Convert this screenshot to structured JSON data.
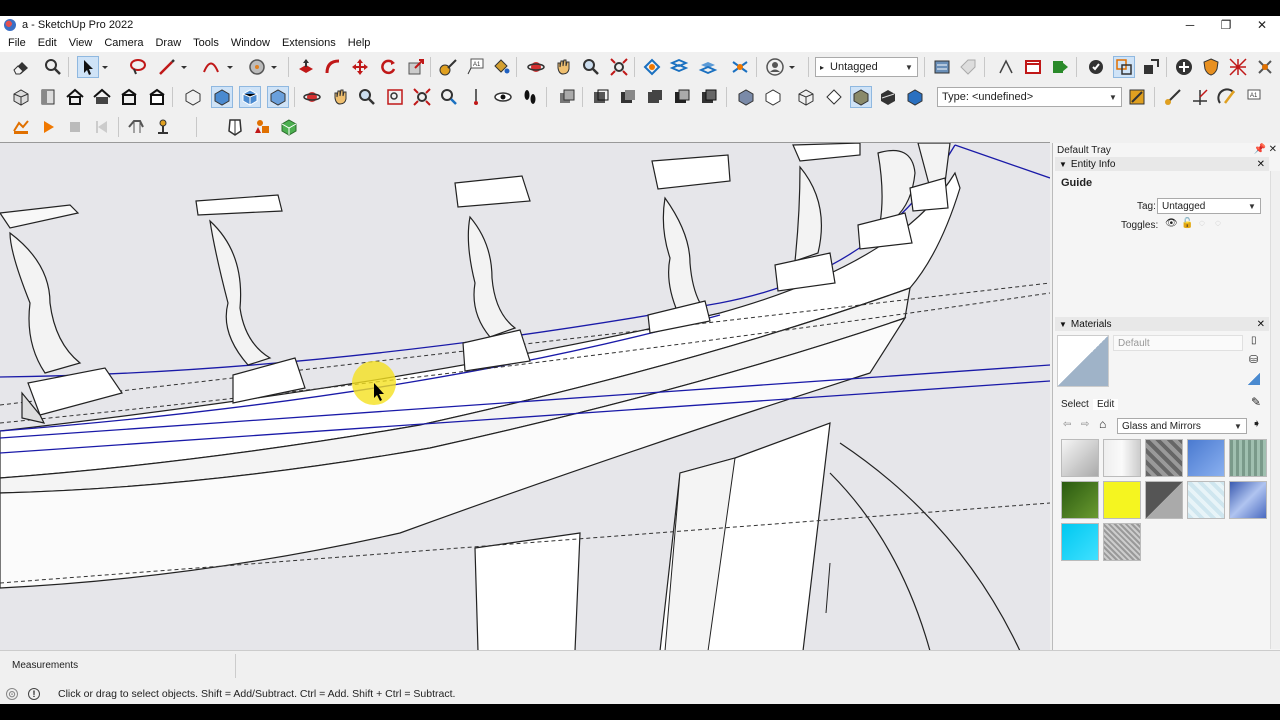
{
  "window": {
    "title": "a - SketchUp Pro 2022",
    "minimize": "─",
    "maximize": "❐",
    "close": "✕"
  },
  "menu": [
    "File",
    "Edit",
    "View",
    "Camera",
    "Draw",
    "Tools",
    "Window",
    "Extensions",
    "Help"
  ],
  "toolbar": {
    "tag_dropdown_value": "Untagged",
    "type_dropdown_value": "Type: <undefined>"
  },
  "tray": {
    "title": "Default Tray",
    "entity_info": {
      "header": "Entity Info",
      "entity_type": "Guide",
      "tag_label": "Tag:",
      "tag_value": "Untagged",
      "toggles_label": "Toggles:"
    },
    "materials": {
      "header": "Materials",
      "current_name": "Default",
      "tab_select": "Select",
      "tab_edit": "Edit",
      "collection": "Glass and Mirrors"
    }
  },
  "measurements": {
    "label": "Measurements",
    "value": ""
  },
  "status": {
    "text": "Click or drag to select objects. Shift = Add/Subtract. Ctrl = Add. Shift + Ctrl = Subtract."
  },
  "colors": {
    "viewport_bg": "#e6e6ea",
    "guide_blue": "#1a1aa8",
    "cursor_highlight": "#f5e11f",
    "accent_orange": "#f07800"
  },
  "icons": {
    "row1": [
      "eraser",
      "search",
      "select",
      "lasso",
      "paint-bucket",
      "line",
      "arc",
      "circle",
      "push-pull",
      "follow-me",
      "move",
      "rotate",
      "scale",
      "tape-measure",
      "text",
      "paint",
      "orbit",
      "pan",
      "zoom",
      "zoom-extents",
      "section-plane",
      "section",
      "section-fill",
      "section-cut",
      "profile"
    ],
    "row2": [
      "views",
      "iso",
      "top",
      "front",
      "right",
      "back",
      "left",
      "move-axes",
      "paint-face",
      "zoom-window",
      "zoom-fit",
      "previous",
      "walk",
      "look",
      "footprints"
    ],
    "row3": [
      "sandbox-from-contours",
      "play",
      "stop",
      "step-back",
      "add-location",
      "terrain",
      "shadows",
      "solid-inspector",
      "3d-warehouse"
    ]
  }
}
